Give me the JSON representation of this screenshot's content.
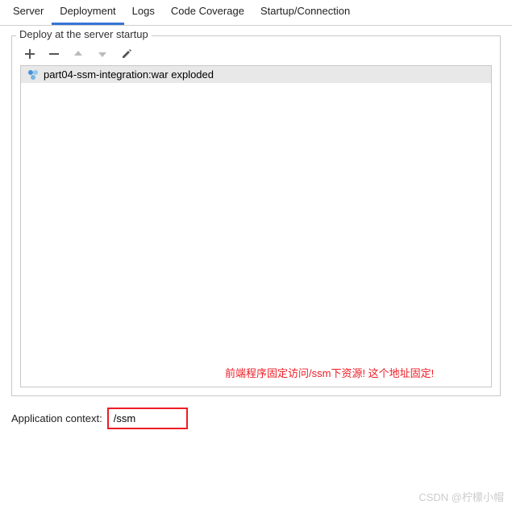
{
  "tabs": {
    "server": "Server",
    "deployment": "Deployment",
    "logs": "Logs",
    "code_coverage": "Code Coverage",
    "startup_connection": "Startup/Connection"
  },
  "fieldset": {
    "label": "Deploy at the server startup"
  },
  "artifacts": [
    {
      "label": "part04-ssm-integration:war exploded"
    }
  ],
  "annotation": "前端程序固定访问/ssm下资源! 这个地址固定!",
  "context": {
    "label": "Application context:",
    "value": "/ssm"
  },
  "watermark": "CSDN @柠檬小帽"
}
